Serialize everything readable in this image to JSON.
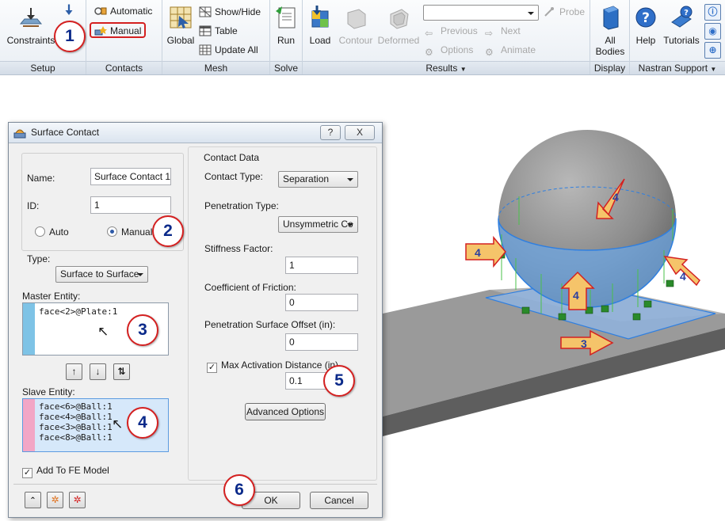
{
  "ribbon": {
    "groups": {
      "setup": "Setup",
      "contacts": "Contacts",
      "mesh": "Mesh",
      "solve": "Solve",
      "results": "Results",
      "display": "Display",
      "nastran_support": "Nastran Support"
    },
    "buttons": {
      "constraints": "Constraints",
      "automatic": "Automatic",
      "manual": "Manual",
      "global": "Global",
      "show_hide": "Show/Hide",
      "table": "Table",
      "update_all": "Update  All",
      "run": "Run",
      "load": "Load",
      "contour": "Contour",
      "deformed": "Deformed",
      "probe": "Probe",
      "previous": "Previous",
      "next": "Next",
      "options": "Options",
      "animate": "Animate",
      "all_bodies_line1": "All",
      "all_bodies_line2": "Bodies",
      "help": "Help",
      "tutorials": "Tutorials"
    },
    "results_dropdown_value": ""
  },
  "dialog": {
    "title": "Surface Contact",
    "help_button": "?",
    "close_button": "X",
    "name_label": "Name:",
    "name_value": "Surface Contact 1",
    "id_label": "ID:",
    "id_value": "1",
    "auto_label": "Auto",
    "manual_label": "Manual",
    "type_label": "Type:",
    "type_value": "Surface to Surface",
    "master_label": "Master Entity:",
    "master_items": [
      "face<2>@Plate:1"
    ],
    "slave_label": "Slave Entity:",
    "slave_items": [
      "face<6>@Ball:1",
      "face<4>@Ball:1",
      "face<3>@Ball:1",
      "face<8>@Ball:1"
    ],
    "add_to_fe_label": "Add To FE Model",
    "contact_data_label": "Contact Data",
    "contact_type_label": "Contact Type:",
    "contact_type_value": "Separation",
    "penetration_type_label": "Penetration Type:",
    "penetration_type_value": "Unsymmetric Co",
    "stiffness_label": "Stiffness Factor:",
    "stiffness_value": "1",
    "friction_label": "Coefficient of Friction:",
    "friction_value": "0",
    "offset_label": "Penetration Surface Offset (in):",
    "offset_value": "0",
    "max_activation_label": "Max Activation Distance (in)",
    "max_activation_value": "0.1",
    "advanced_button": "Advanced Options",
    "ok_button": "OK",
    "cancel_button": "Cancel"
  },
  "callouts": {
    "c1": "1",
    "c2": "2",
    "c3": "3",
    "c4": "4",
    "c5": "5",
    "c6": "6"
  },
  "viewport_arrows": {
    "a1": "4",
    "a2": "4",
    "a3": "4",
    "a4": "4",
    "a5": "3"
  },
  "colors": {
    "callout_border": "#d42020",
    "callout_text": "#0b2a8a",
    "master_strip": "#7ec3e6",
    "slave_strip": "#f2a6c6",
    "selection_blue": "#3d8fe0",
    "arrow_fill": "#f5c46a"
  }
}
